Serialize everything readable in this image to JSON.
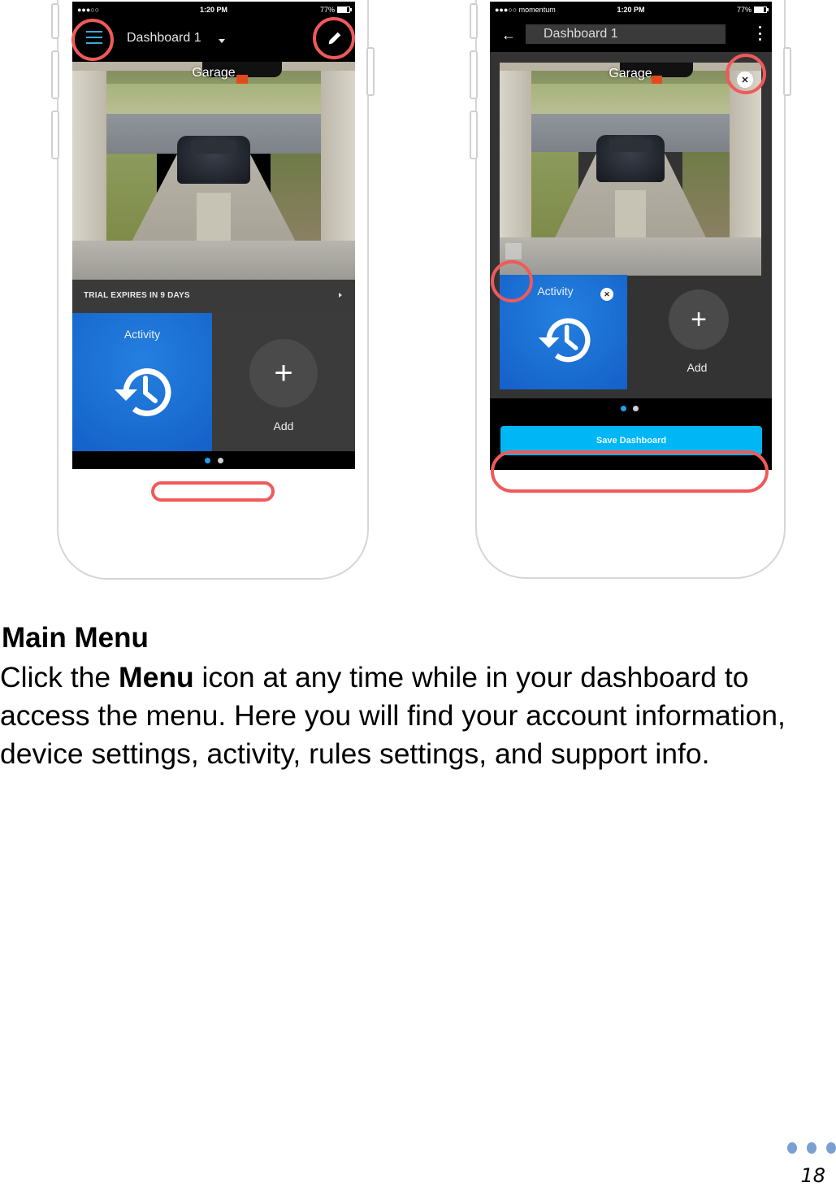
{
  "phone_left": {
    "status_bar": {
      "carrier": "●●●○○ ",
      "time": "1:20 PM",
      "battery": "77%"
    },
    "header": {
      "title": "Dashboard 1",
      "menu_icon": "hamburger-menu-icon",
      "edit_icon": "pencil-icon",
      "dropdown_icon": "caret-down-icon"
    },
    "camera": {
      "label": "Garage"
    },
    "trial_banner": {
      "text": "TRIAL EXPIRES IN 9 DAYS"
    },
    "tiles": {
      "activity_label": "Activity",
      "add_label": "Add",
      "add_symbol": "+"
    },
    "pager": {
      "pages": 2,
      "active_page": 1
    }
  },
  "phone_right": {
    "status_bar": {
      "carrier": "●●●○○ momentum",
      "time": "1:20 PM",
      "battery": "77%"
    },
    "header": {
      "title_value": "Dashboard 1",
      "back_icon": "←",
      "more_icon": "kebab-menu-icon"
    },
    "camera": {
      "label": "Garage",
      "remove_symbol": "✕"
    },
    "tiles": {
      "activity_label": "Activity",
      "remove_symbol": "✕",
      "add_label": "Add",
      "add_symbol": "+"
    },
    "pager": {
      "pages": 2,
      "active_page": 1
    },
    "save_button": "Save Dashboard"
  },
  "highlight_color": "#f05a5a",
  "accent_color": "#00b6f5",
  "content": {
    "heading": "Main Menu",
    "para_prefix": "Click the ",
    "para_bold": "Menu",
    "para_suffix": " icon at any time while in your dashboard to access the menu. Here you will find your account information, device settings, activity, rules settings, and support info."
  },
  "footer": {
    "page_number": "18"
  }
}
